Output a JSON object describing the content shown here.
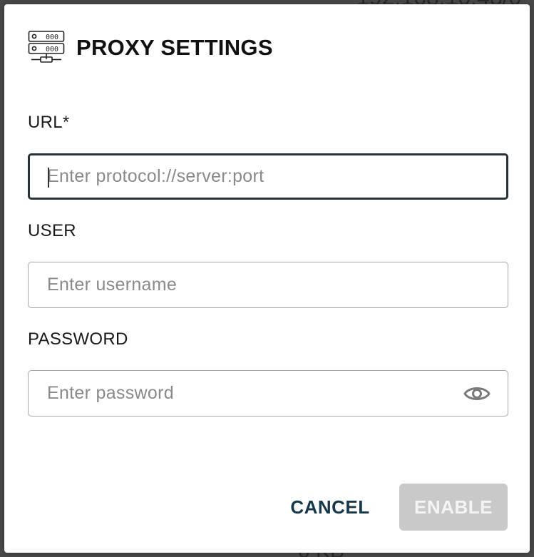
{
  "dialog": {
    "title": "PROXY SETTINGS",
    "icon": "server-network-icon"
  },
  "fields": {
    "url": {
      "label": "URL*",
      "value": "",
      "placeholder": "Enter protocol://server:port"
    },
    "user": {
      "label": "USER",
      "value": "",
      "placeholder": "Enter username"
    },
    "password": {
      "label": "PASSWORD",
      "value": "",
      "placeholder": "Enter password",
      "toggle_icon": "eye-icon"
    }
  },
  "actions": {
    "cancel_label": "CANCEL",
    "enable_label": "ENABLE"
  },
  "colors": {
    "title": "#111111",
    "cancel_text": "#16384a",
    "enable_disabled_bg": "#c9c9c9",
    "focus_border": "#26323a"
  }
}
